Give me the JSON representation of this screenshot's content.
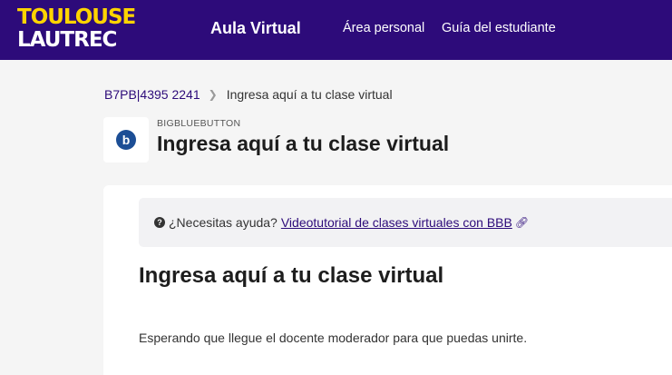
{
  "header": {
    "logo_line1": "TOULOUSE",
    "logo_line2": "LAUTREC",
    "app_title": "Aula Virtual",
    "nav": [
      "Área personal",
      "Guía del estudiante"
    ]
  },
  "breadcrumb": {
    "course": "B7PB|4395 2241",
    "current": "Ingresa aquí a tu clase virtual"
  },
  "activity": {
    "icon_letter": "b",
    "type": "BIGBLUEBUTTON",
    "title": "Ingresa aquí a tu clase virtual"
  },
  "help": {
    "question": "¿Necesitas ayuda?",
    "link_text": "Videotutorial de clases virtuales con BBB"
  },
  "content": {
    "title": "Ingresa aquí a tu clase virtual",
    "status_text": "Esperando que llegue el docente moderador para que puedas unirte."
  },
  "colors": {
    "header_bg": "#2d0b7a",
    "logo_accent": "#ffd400",
    "bbb_blue": "#1c4e95"
  }
}
